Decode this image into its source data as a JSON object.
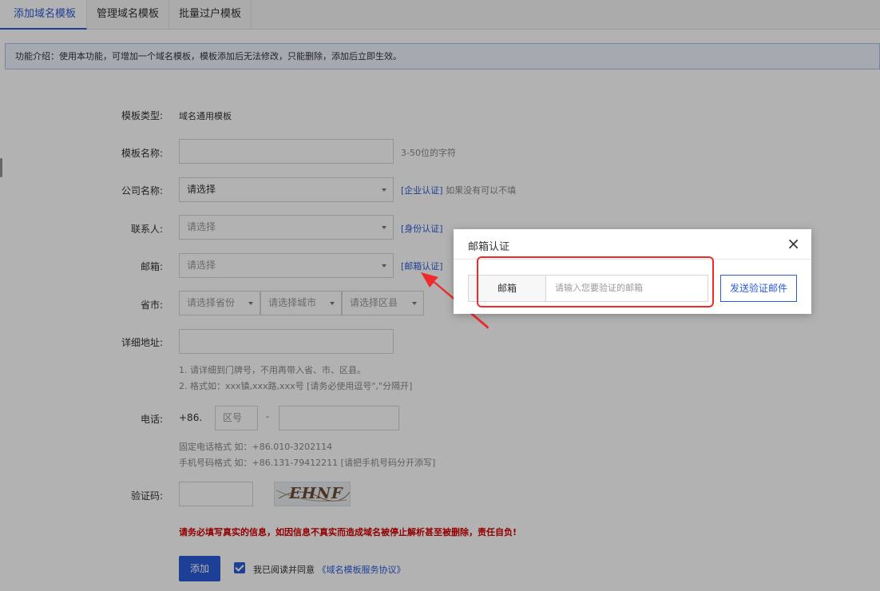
{
  "tabs": [
    {
      "label": "添加域名模板",
      "active": true
    },
    {
      "label": "管理域名模板",
      "active": false
    },
    {
      "label": "批量过户模板",
      "active": false
    }
  ],
  "notice": "功能介绍：使用本功能，可增加一个域名模板，模板添加后无法修改，只能删除，添加后立即生效。",
  "form": {
    "template_type": {
      "label": "模板类型:",
      "value": "域名通用模板"
    },
    "template_name": {
      "label": "模板名称:",
      "value": "",
      "hint": "3-50位的字符"
    },
    "company": {
      "label": "公司名称:",
      "value": "请选择",
      "link": "[企业认证]",
      "hint": "如果没有可以不填"
    },
    "contact": {
      "label": "联系人:",
      "placeholder": "请选择",
      "link": "[身份认证]"
    },
    "email": {
      "label": "邮箱:",
      "placeholder": "请选择",
      "link": "[邮箱认证]"
    },
    "region": {
      "label": "省市:",
      "province": "请选择省份",
      "city": "请选择城市",
      "district": "请选择区县"
    },
    "address": {
      "label": "详细地址:",
      "value": "",
      "hints": [
        "1. 请详细到门牌号，不用再带入省、市、区县。",
        "2. 格式如：xxx镇,xxx路,xxx号 [请务必使用逗号\",\"分隔开]"
      ]
    },
    "phone": {
      "label": "电话:",
      "prefix": "+86.",
      "area_placeholder": "区号",
      "dash": "-",
      "hints": [
        "固定电话格式 如：+86.010-3202114",
        "手机号码格式 如：+86.131-79412211 [请把手机号码分开添写]"
      ]
    },
    "captcha": {
      "label": "验证码:",
      "image_text": "EHNF"
    },
    "warning": "请务必填写真实的信息，如因信息不真实而造成域名被停止解析甚至被删除，责任自负!",
    "submit_label": "添加",
    "agree_text": "我已阅读并同意",
    "agree_link": "《域名模板服务协议》"
  },
  "modal": {
    "title": "邮箱认证",
    "close_icon": "×",
    "field_label": "邮箱",
    "field_placeholder": "请输入您要验证的邮箱",
    "send_label": "发送验证邮件"
  },
  "colors": {
    "accent": "#2b5bd7",
    "warning": "#d40000",
    "highlight": "#ee2a2a"
  }
}
